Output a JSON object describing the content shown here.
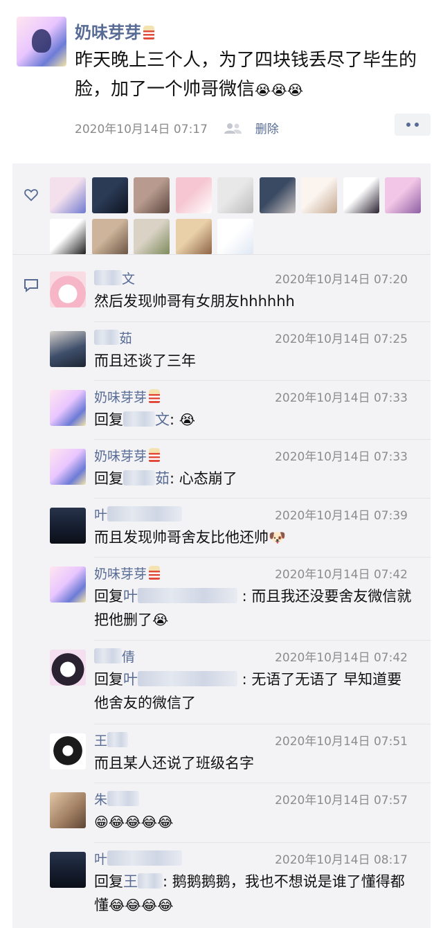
{
  "post": {
    "author": "奶味芽芽",
    "author_badge": "popcorn-emoji",
    "text": "昨天晚上三个人，为了四块钱丢尽了毕生的脸，加了一个帅哥微信",
    "text_emoji": "😭😭😭",
    "timestamp": "2020年10月14日 07:17",
    "delete_label": "删除",
    "visibility_icon": "people-icon"
  },
  "likes": {
    "icon": "heart-icon",
    "avatars": [
      {
        "color1": "#f4e0ec",
        "color2": "#6f7ad0"
      },
      {
        "color1": "#2b3a55",
        "color2": "#0d1420"
      },
      {
        "color1": "#b89b8e",
        "color2": "#5b463f"
      },
      {
        "color1": "#f6c7d2",
        "color2": "#ffffff"
      },
      {
        "color1": "#e8e8e8",
        "color2": "#bcbcbc"
      },
      {
        "color1": "#3b4a63",
        "color2": "#c8c2c0"
      },
      {
        "color1": "#fbf4ef",
        "color2": "#c4a890"
      },
      {
        "color1": "#ffffff",
        "color2": "#2a2230"
      },
      {
        "color1": "#f2c6e6",
        "color2": "#8d5fa3"
      },
      {
        "color1": "#ffffff",
        "color2": "#1b1b1b"
      },
      {
        "color1": "#cdb49a",
        "color2": "#6a5544"
      },
      {
        "color1": "#d9d2c5",
        "color2": "#7d8a5b"
      },
      {
        "color1": "#e9d0a9",
        "color2": "#8c6245"
      },
      {
        "color1": "#ffffff",
        "color2": "#dfe7f4"
      }
    ]
  },
  "comments": [
    {
      "name": "文",
      "name_mask": 40,
      "time": "2020年10月14日 07:20",
      "avatar": "my-melody",
      "text": "然后发现帅哥有女朋友hhhhhh"
    },
    {
      "name": "茹",
      "name_mask": 36,
      "time": "2020年10月14日 07:25",
      "avatar": "girl-photo",
      "text": "而且还谈了三年"
    },
    {
      "name": "奶味芽芽",
      "badge": true,
      "time": "2020年10月14日 07:33",
      "avatar": "self",
      "reply_prefix": "回复",
      "reply_to": "文",
      "reply_mask": 46,
      "text": ": ",
      "emoji": "😭"
    },
    {
      "name": "奶味芽芽",
      "badge": true,
      "time": "2020年10月14日 07:33",
      "avatar": "self",
      "reply_prefix": "回复",
      "reply_to": "茹",
      "reply_mask": 46,
      "text": ": 心态崩了"
    },
    {
      "name": "叶",
      "name_mask": 108,
      "time": "2020年10月14日 07:39",
      "avatar": "night-sky",
      "text": "而且发现帅哥舍友比他还帅",
      "emoji": "🐶"
    },
    {
      "name": "奶味芽芽",
      "badge": true,
      "time": "2020年10月14日 07:42",
      "avatar": "self",
      "reply_prefix": "回复",
      "reply_to": "叶",
      "reply_mask": 144,
      "text": " : 而且我还没要舍友微信就把他删了",
      "emoji": "😭"
    },
    {
      "name": "倩",
      "name_mask": 40,
      "time": "2020年10月14日 07:42",
      "avatar": "kuromi",
      "reply_prefix": "回复",
      "reply_to": "叶",
      "reply_mask": 144,
      "text": " : 无语了无语了 早知道要他舍友的微信了"
    },
    {
      "name": "王",
      "name_mask": 30,
      "time": "2020年10月14日 07:51",
      "avatar": "anime-girl",
      "text": "而且某人还说了班级名字"
    },
    {
      "name": "朱",
      "name_mask": 46,
      "time": "2020年10月14日 07:57",
      "avatar": "warm-photo",
      "text": "",
      "emoji": "😁😂😂😂😂"
    },
    {
      "name": "叶",
      "name_mask": 108,
      "time": "2020年10月14日 08:17",
      "avatar": "night-sky",
      "reply_prefix": "回复",
      "reply_to": "王",
      "reply_mask": 36,
      "text": ": 鹅鹅鹅鹅，我也不想说是谁了懂得都懂",
      "emoji": "😂😂😂😂"
    }
  ]
}
